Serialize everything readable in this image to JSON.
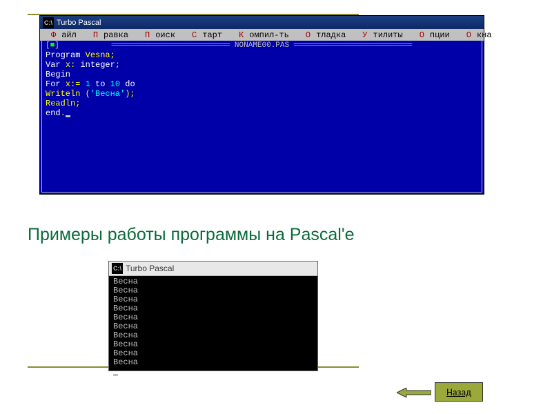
{
  "top_window": {
    "title": "Turbo Pascal",
    "filename_header": "NONAME00.PAS",
    "menu": [
      "Файл",
      "Правка",
      "Поиск",
      "Старт",
      "Компил-ть",
      "Отладка",
      "Утилиты",
      "Опции",
      "Окна"
    ],
    "code_tokens": [
      [
        [
          "kw",
          "Program"
        ],
        [
          "sp",
          " "
        ],
        [
          "id",
          "Vesna"
        ],
        [
          "sym",
          ";"
        ]
      ],
      [
        [
          "kw",
          "Var"
        ],
        [
          "sp",
          " "
        ],
        [
          "id",
          "x"
        ],
        [
          "sym",
          ": "
        ],
        [
          "kw",
          "integer"
        ],
        [
          "sym",
          ";"
        ]
      ],
      [
        [
          "kw",
          "Begin"
        ]
      ],
      [
        [
          "kw",
          "For"
        ],
        [
          "sp",
          " "
        ],
        [
          "id",
          "x"
        ],
        [
          "sym",
          ":= "
        ],
        [
          "num",
          "1"
        ],
        [
          "sp",
          " "
        ],
        [
          "kw",
          "to"
        ],
        [
          "sp",
          " "
        ],
        [
          "num",
          "10"
        ],
        [
          "sp",
          " "
        ],
        [
          "kw",
          "do"
        ]
      ],
      [
        [
          "id",
          "Writeln"
        ],
        [
          "sp",
          " "
        ],
        [
          "sym",
          "("
        ],
        [
          "str",
          "'Весна'"
        ],
        [
          "sym",
          ")"
        ],
        [
          "sym",
          ";"
        ]
      ],
      [
        [
          "id",
          "Readln"
        ],
        [
          "sym",
          ";"
        ]
      ],
      [
        [
          "kw",
          "end"
        ],
        [
          "sym",
          "."
        ],
        [
          "cursor",
          ""
        ]
      ]
    ]
  },
  "heading": "Примеры работы программы на Pascal'e",
  "output_window": {
    "title": "Turbo Pascal",
    "lines": [
      "Весна",
      "Весна",
      "Весна",
      "Весна",
      "Весна",
      "Весна",
      "Весна",
      "Весна",
      "Весна",
      "Весна"
    ]
  },
  "back_button": {
    "label": "Назад"
  },
  "colors": {
    "slide_accent": "#8a8a2a",
    "heading": "#0a6b3a",
    "editor_bg": "#0000a8"
  }
}
